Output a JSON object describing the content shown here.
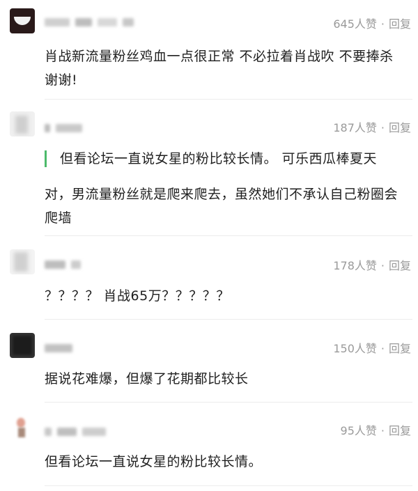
{
  "comments": [
    {
      "likes": "645人赞",
      "separator": "·",
      "reply": "回复",
      "text": "肖战新流量粉丝鸡血一点很正常 不必拉着肖战吹 不要捧杀 谢谢!"
    },
    {
      "likes": "187人赞",
      "separator": "·",
      "reply": "回复",
      "quote": "但看论坛一直说女星的粉比较长情。 可乐西瓜棒夏天",
      "text": "对，男流量粉丝就是爬来爬去，虽然她们不承认自己粉圈会爬墙"
    },
    {
      "likes": "178人赞",
      "separator": "·",
      "reply": "回复",
      "text": "？？？？ 肖战65万？？？？？"
    },
    {
      "likes": "150人赞",
      "separator": "·",
      "reply": "回复",
      "text": "据说花难爆，但爆了花期都比较长"
    },
    {
      "likes": "95人赞",
      "separator": "·",
      "reply": "回复",
      "text": "但看论坛一直说女星的粉比较长情。"
    }
  ],
  "colors": {
    "quote_bar": "#4cba6b",
    "meta_text": "#9a9a9a",
    "divider": "#ececec"
  }
}
